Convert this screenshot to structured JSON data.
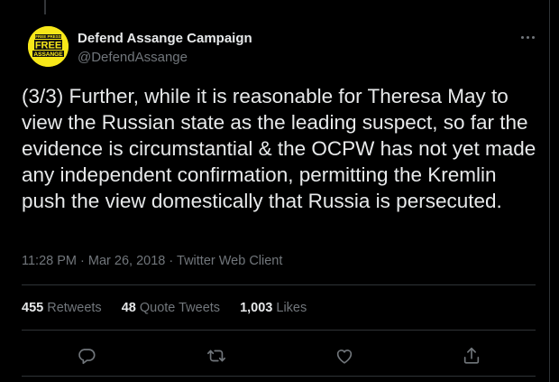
{
  "colors": {
    "background": "#000000",
    "text_primary": "#e7e9ea",
    "text_secondary": "#71767b",
    "divider": "#2f3336",
    "avatar_yellow": "#f7e719"
  },
  "author": {
    "display_name": "Defend Assange Campaign",
    "handle": "@DefendAssange",
    "avatar_lettering": [
      "FREE PRESS",
      "FREE",
      "ASSANGE"
    ]
  },
  "tweet": {
    "text": "(3/3) Further, while it is reasonable for Theresa May to view the Russian state as the leading suspect, so far the evidence is circumstantial & the OCPW has not yet made any independent confirmation, permitting the Kremlin push the view domestically that Russia is persecuted.",
    "time": "11:28 PM",
    "date": "Mar 26, 2018",
    "source": "Twitter Web Client",
    "separator": "·"
  },
  "stats": {
    "retweets_count": "455",
    "retweets_label": "Retweets",
    "quotes_count": "48",
    "quotes_label": "Quote Tweets",
    "likes_count": "1,003",
    "likes_label": "Likes"
  },
  "icons": {
    "more": "more-icon",
    "reply": "reply-icon",
    "retweet": "retweet-icon",
    "like": "like-icon",
    "share": "share-icon"
  }
}
